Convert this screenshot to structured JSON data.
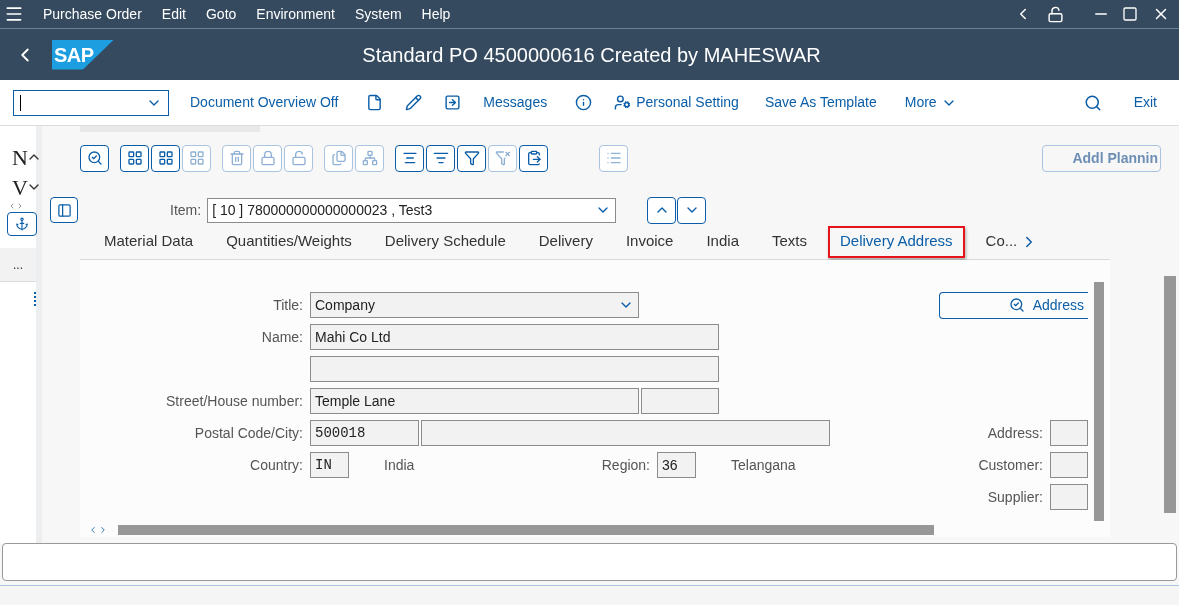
{
  "menu_bar": {
    "items": [
      "Purchase Order",
      "Edit",
      "Goto",
      "Environment",
      "System",
      "Help"
    ]
  },
  "title_bar": {
    "logo": "SAP",
    "title": "Standard PO 4500000616 Created by MAHESWAR"
  },
  "toolbar": {
    "items": [
      {
        "kind": "text",
        "label": "Document Overview Off"
      },
      {
        "kind": "icon"
      },
      {
        "kind": "icon"
      },
      {
        "kind": "icon"
      },
      {
        "kind": "text",
        "label": "Messages"
      },
      {
        "kind": "icon"
      },
      {
        "kind": "icon_text",
        "label": "Personal Setting"
      },
      {
        "kind": "text",
        "label": "Save As Template"
      },
      {
        "kind": "menu",
        "label": "More"
      }
    ],
    "exit": "Exit"
  },
  "left_strip": {
    "letters": [
      "N",
      "V"
    ],
    "more": "..."
  },
  "icon_toolbar": {
    "groups": [
      [
        {
          "disabled": false
        }
      ],
      [
        {
          "disabled": false
        },
        {
          "disabled": false
        },
        {
          "disabled": true
        }
      ],
      [
        {
          "disabled": true
        },
        {
          "disabled": true
        },
        {
          "disabled": true
        }
      ],
      [
        {
          "disabled": true
        },
        {
          "disabled": true
        }
      ],
      [
        {
          "disabled": false
        },
        {
          "disabled": false
        },
        {
          "disabled": false
        },
        {
          "disabled": true
        },
        {
          "disabled": false
        }
      ],
      [
        {
          "disabled": true
        }
      ]
    ],
    "side_button": "Addl Plannin"
  },
  "item": {
    "label": "Item:",
    "value": "[ 10 ] 780000000000000023 , Test3"
  },
  "tabs": [
    {
      "label": "Material Data",
      "selected": false
    },
    {
      "label": "Quantities/Weights",
      "selected": false
    },
    {
      "label": "Delivery Schedule",
      "selected": false
    },
    {
      "label": "Delivery",
      "selected": false
    },
    {
      "label": "Invoice",
      "selected": false
    },
    {
      "label": "India",
      "selected": false
    },
    {
      "label": "Texts",
      "selected": false
    },
    {
      "label": "Delivery Address",
      "selected": true
    },
    {
      "label": "Co...",
      "selected": false
    }
  ],
  "address_form": {
    "title": {
      "label": "Title:",
      "value": "Company"
    },
    "name": {
      "label": "Name:",
      "value": "Mahi Co Ltd"
    },
    "street": {
      "label": "Street/House number:",
      "value": "Temple Lane"
    },
    "postal": {
      "label": "Postal Code/City:",
      "value": "500018"
    },
    "country": {
      "label": "Country:",
      "code": "IN",
      "name": "India"
    },
    "region": {
      "label": "Region:",
      "code": "36",
      "name": "Telangana"
    },
    "address_button": "Address",
    "side_fields": [
      "Address:",
      "Customer:",
      "Supplier:"
    ]
  }
}
